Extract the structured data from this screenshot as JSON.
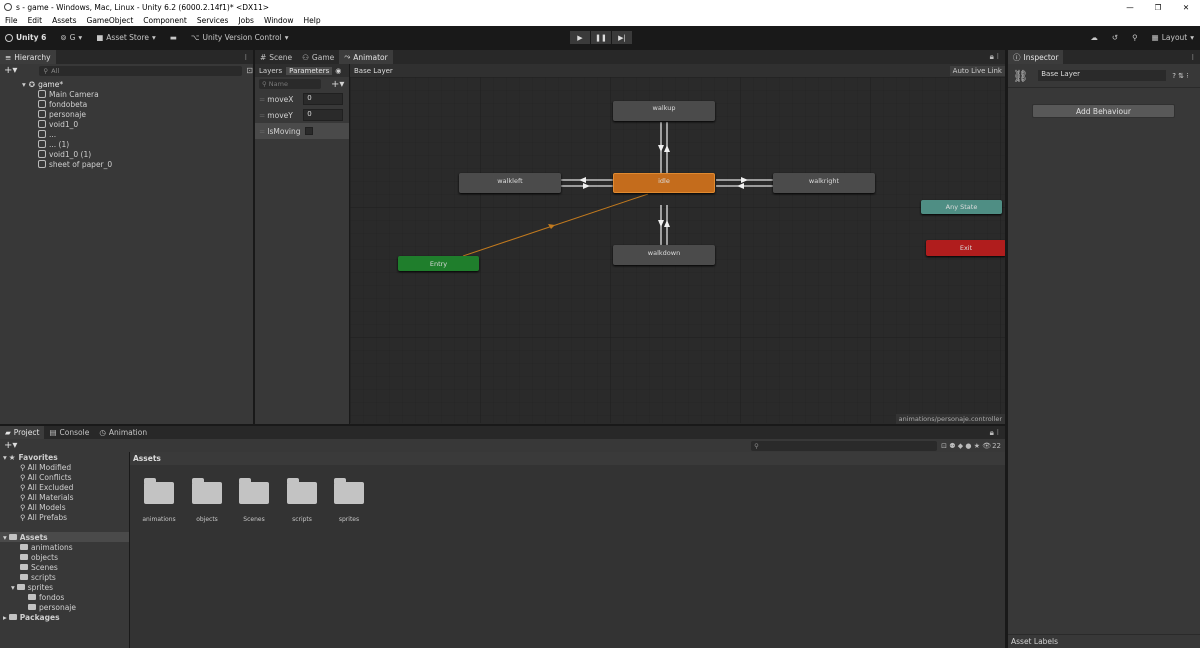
{
  "window": {
    "title": "s - game - Windows, Mac, Linux - Unity 6.2 (6000.2.14f1)* <DX11>"
  },
  "menu": [
    "File",
    "Edit",
    "Assets",
    "GameObject",
    "Component",
    "Services",
    "Jobs",
    "Window",
    "Help"
  ],
  "toolbar": {
    "account": "Unity 6",
    "user": "G",
    "asset_store": "Asset Store",
    "version_control": "Unity Version Control",
    "layout": "Layout"
  },
  "hierarchy": {
    "tab": "Hierarchy",
    "search_placeholder": "All",
    "scene": "game*",
    "items": [
      "Main Camera",
      "fondobeta",
      "personaje",
      "void1_0",
      "...",
      "... (1)",
      "void1_0 (1)",
      "sheet of paper_0"
    ]
  },
  "center_tabs": {
    "scene": "Scene",
    "game": "Game",
    "animator": "Animator"
  },
  "animator": {
    "layers_tab": "Layers",
    "parameters_tab": "Parameters",
    "breadcrumb": "Base Layer",
    "auto_live_link": "Auto Live Link",
    "name_placeholder": "Name",
    "params": [
      {
        "name": "moveX",
        "value": "0"
      },
      {
        "name": "moveY",
        "value": "0"
      },
      {
        "name": "IsMoving",
        "value": ""
      }
    ],
    "states": {
      "walkup": "walkup",
      "walkleft": "walkleft",
      "idle": "idle",
      "walkright": "walkright",
      "any_state": "Any State",
      "walkdown": "walkdown",
      "exit": "Exit",
      "entry": "Entry"
    },
    "footer_path": "animations/personaje.controller",
    "colors": {
      "idle": "#c46c1c",
      "entry": "#1f7e2c",
      "exit": "#b01d1d",
      "any_state": "#4f8e84",
      "state": "#4b4b4b"
    }
  },
  "inspector": {
    "tab": "Inspector",
    "title": "Base Layer",
    "add_behaviour": "Add Behaviour",
    "asset_labels": "Asset Labels"
  },
  "bottom_tabs": {
    "project": "Project",
    "console": "Console",
    "animation": "Animation"
  },
  "project": {
    "favorites_label": "Favorites",
    "favorites": [
      "All Modified",
      "All Conflicts",
      "All Excluded",
      "All Materials",
      "All Models",
      "All Prefabs"
    ],
    "assets_label": "Assets",
    "asset_folders": [
      "animations",
      "objects",
      "Scenes",
      "scripts",
      "sprites"
    ],
    "sprite_subfolders": [
      "fondos",
      "personaje"
    ],
    "packages_label": "Packages",
    "breadcrumb": "Assets",
    "grid_items": [
      "animations",
      "objects",
      "Scenes",
      "scripts",
      "sprites"
    ],
    "hidden_count": "22"
  }
}
